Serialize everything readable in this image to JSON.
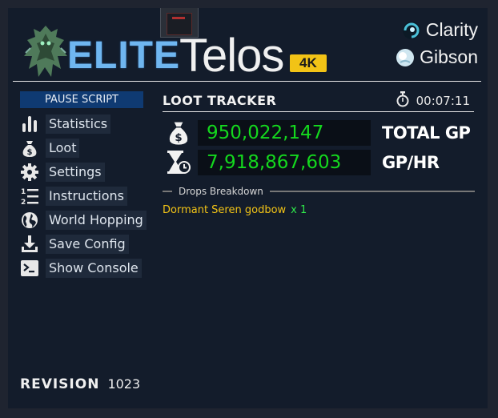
{
  "header": {
    "logo_word1": "ELITE",
    "logo_word2": "Telos",
    "badge": "4K",
    "accounts": [
      {
        "name": "Clarity",
        "icon": "clarity-avatar-icon"
      },
      {
        "name": "Gibson",
        "icon": "gibson-avatar-icon"
      }
    ]
  },
  "sidebar": {
    "pause_label": "PAUSE SCRIPT",
    "items": [
      {
        "label": "Statistics",
        "icon": "bar-chart-icon"
      },
      {
        "label": "Loot",
        "icon": "money-bag-icon"
      },
      {
        "label": "Settings",
        "icon": "gear-icon"
      },
      {
        "label": "Instructions",
        "icon": "numbered-list-icon"
      },
      {
        "label": "World Hopping",
        "icon": "globe-icon"
      },
      {
        "label": "Save Config",
        "icon": "download-icon"
      },
      {
        "label": "Show Console",
        "icon": "terminal-icon"
      }
    ],
    "revision_label": "REVISION",
    "revision_value": "1023"
  },
  "loot_tracker": {
    "title": "LOOT TRACKER",
    "timer": "00:07:11",
    "total_gp_value": "950,022,147",
    "total_gp_label": "TOTAL GP",
    "gp_hr_value": "7,918,867,603",
    "gp_hr_label": "GP/HR",
    "drops_header": "Drops Breakdown",
    "drops": [
      {
        "name": "Dormant Seren godbow",
        "qty": "x 1"
      }
    ]
  },
  "colors": {
    "panel_bg": "#131c2b",
    "accent_blue": "#0f3a72",
    "value_green": "#14d81e",
    "drop_yellow": "#f2c316",
    "badge_yellow": "#f2c316"
  }
}
